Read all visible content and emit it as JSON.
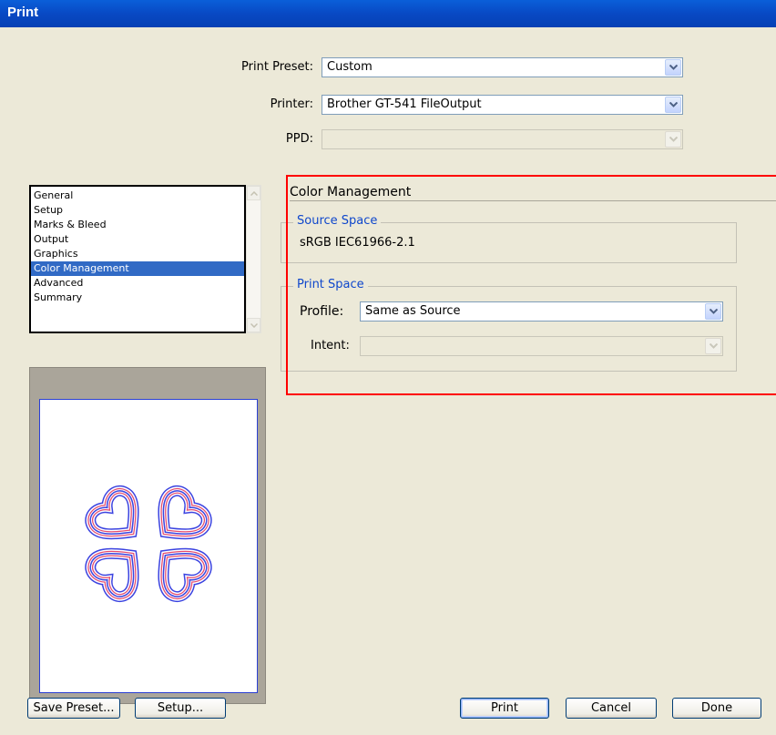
{
  "window": {
    "title": "Print"
  },
  "preset": {
    "label": "Print Preset:",
    "value": "Custom"
  },
  "printer": {
    "label": "Printer:",
    "value": "Brother GT-541 FileOutput"
  },
  "ppd": {
    "label": "PPD:",
    "value": ""
  },
  "categories": {
    "items": [
      "General",
      "Setup",
      "Marks & Bleed",
      "Output",
      "Graphics",
      "Color Management",
      "Advanced",
      "Summary"
    ],
    "selected": "Color Management"
  },
  "section": {
    "title": "Color Management"
  },
  "source_space": {
    "legend": "Source Space",
    "value": "sRGB IEC61966-2.1"
  },
  "print_space": {
    "legend": "Print Space",
    "profile_label": "Profile:",
    "profile_value": "Same as Source",
    "intent_label": "Intent:",
    "intent_value": ""
  },
  "buttons": {
    "save_preset": "Save Preset...",
    "setup": "Setup...",
    "print": "Print",
    "cancel": "Cancel",
    "done": "Done"
  },
  "colors": {
    "selection": "#316AC5",
    "legend_text": "#0F47CC",
    "highlight_box": "#FF0000",
    "title_bar": "#0A5FD9"
  }
}
